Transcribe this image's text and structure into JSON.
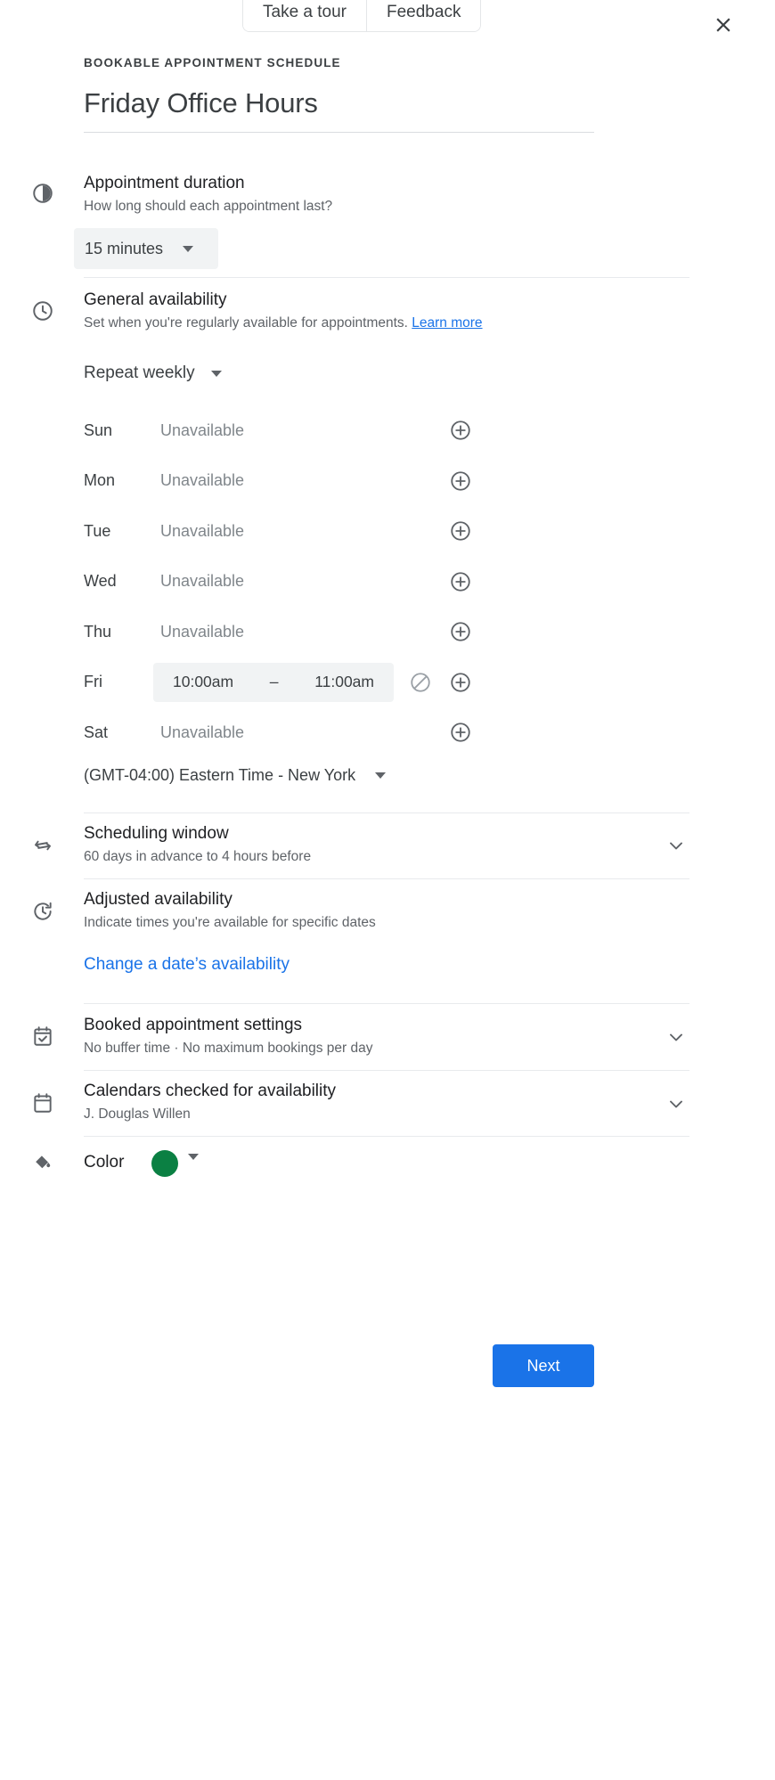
{
  "top_tabs": [
    {
      "label": "Take a tour",
      "name": "take-a-tour-tab"
    },
    {
      "label": "Feedback",
      "name": "feedback-tab"
    }
  ],
  "header": {
    "eyebrow": "BOOKABLE APPOINTMENT SCHEDULE",
    "title": "Friday Office Hours"
  },
  "duration": {
    "title": "Appointment duration",
    "subtitle": "How long should each appointment last?",
    "value": "15 minutes"
  },
  "general_availability": {
    "title": "General availability",
    "subtitle": "Set when you're regularly available for appointments.",
    "learn_more": "Learn more",
    "repeat": "Repeat weekly",
    "timezone": "(GMT-04:00) Eastern Time - New York",
    "unavailable_label": "Unavailable",
    "days": [
      {
        "day": "Sun",
        "available": false,
        "status": "Unavailable"
      },
      {
        "day": "Mon",
        "available": false,
        "status": "Unavailable"
      },
      {
        "day": "Tue",
        "available": false,
        "status": "Unavailable"
      },
      {
        "day": "Wed",
        "available": false,
        "status": "Unavailable"
      },
      {
        "day": "Thu",
        "available": false,
        "status": "Unavailable"
      },
      {
        "day": "Fri",
        "available": true,
        "start": "10:00am",
        "dash": "–",
        "end": "11:00am"
      },
      {
        "day": "Sat",
        "available": false,
        "status": "Unavailable"
      }
    ]
  },
  "scheduling_window": {
    "title": "Scheduling window",
    "subtitle": "60 days in advance to 4 hours before"
  },
  "adjusted_availability": {
    "title": "Adjusted availability",
    "subtitle": "Indicate times you're available for specific dates",
    "link": "Change a date’s availability"
  },
  "booked_settings": {
    "title": "Booked appointment settings",
    "subtitle": "No buffer time · No maximum bookings per day"
  },
  "calendars_checked": {
    "title": "Calendars checked for availability",
    "subtitle": "J. Douglas Willen"
  },
  "color": {
    "label": "Color",
    "value": "#0b8043"
  },
  "footer": {
    "next_label": "Next"
  },
  "theme": {
    "accent": "#1a73e8",
    "text_primary": "#202124",
    "text_secondary": "#5f6368",
    "chip_bg": "#f1f3f4"
  }
}
